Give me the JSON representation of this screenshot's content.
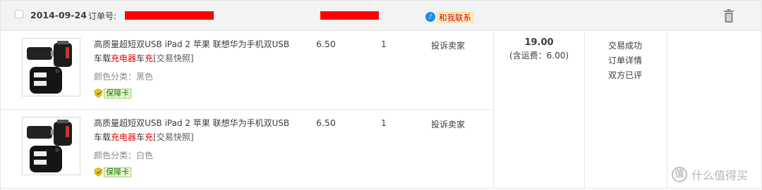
{
  "header": {
    "date": "2014-09-24",
    "order_label": "订单号:",
    "contact_link": "和我联系"
  },
  "items": [
    {
      "title_part1": "高质量超短双USB iPad 2 苹果 联想华为手机双USB",
      "title_part2": "车载",
      "title_hl1": "充电器",
      "title_mid": "车",
      "title_hl2": "充",
      "snapshot": "[交易快照]",
      "sku": "颜色分类：黑色",
      "badge": "保障卡",
      "price": "6.50",
      "qty": "1",
      "complain": "投诉卖家"
    },
    {
      "title_part1": "高质量超短双USB iPad 2 苹果 联想华为手机双USB",
      "title_part2": "车载",
      "title_hl1": "充电器",
      "title_mid": "车",
      "title_hl2": "充",
      "snapshot": "[交易快照]",
      "sku": "颜色分类：白色",
      "badge": "保障卡",
      "price": "6.50",
      "qty": "1",
      "complain": "投诉卖家"
    }
  ],
  "total": {
    "amount": "19.00",
    "shipping": "(含运费：6.00)"
  },
  "status": {
    "line1": "交易成功",
    "line2": "订单详情",
    "line3": "双方已评"
  },
  "watermark": "什么值得买",
  "colors": {
    "redaction": "#ff0000",
    "highlight": "#e60000",
    "header_bg": "#f3f3f3",
    "border": "#e6e6e6"
  },
  "icons": {
    "trash": "trash-icon",
    "contact": "chat-icon",
    "badge": "shield-icon"
  }
}
